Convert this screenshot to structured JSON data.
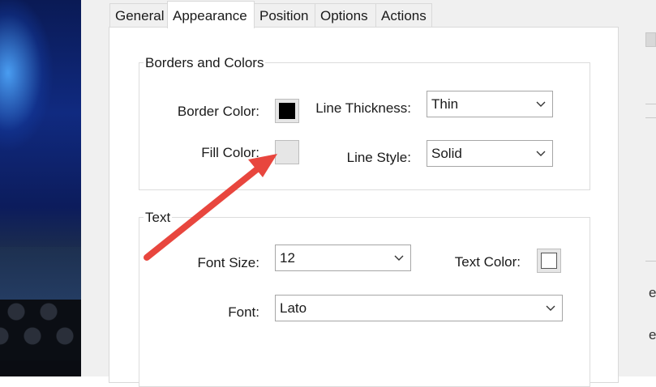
{
  "tabs": [
    {
      "label": "General"
    },
    {
      "label": "Appearance"
    },
    {
      "label": "Position"
    },
    {
      "label": "Options"
    },
    {
      "label": "Actions"
    }
  ],
  "borders_group": {
    "title": "Borders and Colors",
    "border_color_label": "Border Color:",
    "border_color": "#000000",
    "fill_color_label": "Fill Color:",
    "fill_color": "#e6e6e6",
    "line_thickness_label": "Line Thickness:",
    "line_thickness_value": "Thin",
    "line_style_label": "Line Style:",
    "line_style_value": "Solid"
  },
  "text_group": {
    "title": "Text",
    "font_size_label": "Font Size:",
    "font_size_value": "12",
    "text_color_label": "Text Color:",
    "text_color": "#ffffff",
    "font_label": "Font:",
    "font_value": "Lato"
  },
  "annotation": {
    "arrow_color": "#e8463e",
    "arrow_icon": "red-arrow-annotation"
  },
  "right_edge": {
    "glyphs": [
      "e",
      "e"
    ]
  }
}
